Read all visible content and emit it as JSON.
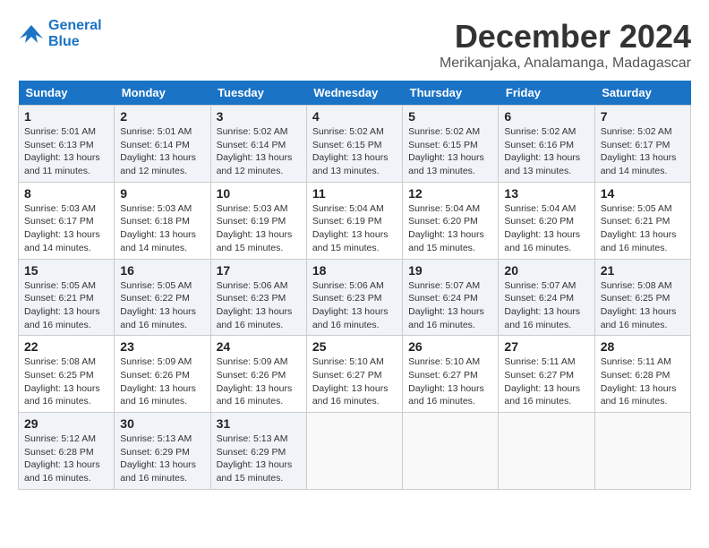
{
  "header": {
    "logo_line1": "General",
    "logo_line2": "Blue",
    "month_year": "December 2024",
    "location": "Merikanjaka, Analamanga, Madagascar"
  },
  "calendar": {
    "days_of_week": [
      "Sunday",
      "Monday",
      "Tuesday",
      "Wednesday",
      "Thursday",
      "Friday",
      "Saturday"
    ],
    "weeks": [
      [
        {
          "day": "",
          "info": ""
        },
        {
          "day": "2",
          "info": "Sunrise: 5:01 AM\nSunset: 6:14 PM\nDaylight: 13 hours\nand 12 minutes."
        },
        {
          "day": "3",
          "info": "Sunrise: 5:02 AM\nSunset: 6:14 PM\nDaylight: 13 hours\nand 12 minutes."
        },
        {
          "day": "4",
          "info": "Sunrise: 5:02 AM\nSunset: 6:15 PM\nDaylight: 13 hours\nand 13 minutes."
        },
        {
          "day": "5",
          "info": "Sunrise: 5:02 AM\nSunset: 6:15 PM\nDaylight: 13 hours\nand 13 minutes."
        },
        {
          "day": "6",
          "info": "Sunrise: 5:02 AM\nSunset: 6:16 PM\nDaylight: 13 hours\nand 13 minutes."
        },
        {
          "day": "7",
          "info": "Sunrise: 5:02 AM\nSunset: 6:17 PM\nDaylight: 13 hours\nand 14 minutes."
        }
      ],
      [
        {
          "day": "1",
          "info": "Sunrise: 5:01 AM\nSunset: 6:13 PM\nDaylight: 13 hours\nand 11 minutes."
        },
        null,
        null,
        null,
        null,
        null,
        null
      ],
      [
        {
          "day": "8",
          "info": "Sunrise: 5:03 AM\nSunset: 6:17 PM\nDaylight: 13 hours\nand 14 minutes."
        },
        {
          "day": "9",
          "info": "Sunrise: 5:03 AM\nSunset: 6:18 PM\nDaylight: 13 hours\nand 14 minutes."
        },
        {
          "day": "10",
          "info": "Sunrise: 5:03 AM\nSunset: 6:19 PM\nDaylight: 13 hours\nand 15 minutes."
        },
        {
          "day": "11",
          "info": "Sunrise: 5:04 AM\nSunset: 6:19 PM\nDaylight: 13 hours\nand 15 minutes."
        },
        {
          "day": "12",
          "info": "Sunrise: 5:04 AM\nSunset: 6:20 PM\nDaylight: 13 hours\nand 15 minutes."
        },
        {
          "day": "13",
          "info": "Sunrise: 5:04 AM\nSunset: 6:20 PM\nDaylight: 13 hours\nand 16 minutes."
        },
        {
          "day": "14",
          "info": "Sunrise: 5:05 AM\nSunset: 6:21 PM\nDaylight: 13 hours\nand 16 minutes."
        }
      ],
      [
        {
          "day": "15",
          "info": "Sunrise: 5:05 AM\nSunset: 6:21 PM\nDaylight: 13 hours\nand 16 minutes."
        },
        {
          "day": "16",
          "info": "Sunrise: 5:05 AM\nSunset: 6:22 PM\nDaylight: 13 hours\nand 16 minutes."
        },
        {
          "day": "17",
          "info": "Sunrise: 5:06 AM\nSunset: 6:23 PM\nDaylight: 13 hours\nand 16 minutes."
        },
        {
          "day": "18",
          "info": "Sunrise: 5:06 AM\nSunset: 6:23 PM\nDaylight: 13 hours\nand 16 minutes."
        },
        {
          "day": "19",
          "info": "Sunrise: 5:07 AM\nSunset: 6:24 PM\nDaylight: 13 hours\nand 16 minutes."
        },
        {
          "day": "20",
          "info": "Sunrise: 5:07 AM\nSunset: 6:24 PM\nDaylight: 13 hours\nand 16 minutes."
        },
        {
          "day": "21",
          "info": "Sunrise: 5:08 AM\nSunset: 6:25 PM\nDaylight: 13 hours\nand 16 minutes."
        }
      ],
      [
        {
          "day": "22",
          "info": "Sunrise: 5:08 AM\nSunset: 6:25 PM\nDaylight: 13 hours\nand 16 minutes."
        },
        {
          "day": "23",
          "info": "Sunrise: 5:09 AM\nSunset: 6:26 PM\nDaylight: 13 hours\nand 16 minutes."
        },
        {
          "day": "24",
          "info": "Sunrise: 5:09 AM\nSunset: 6:26 PM\nDaylight: 13 hours\nand 16 minutes."
        },
        {
          "day": "25",
          "info": "Sunrise: 5:10 AM\nSunset: 6:27 PM\nDaylight: 13 hours\nand 16 minutes."
        },
        {
          "day": "26",
          "info": "Sunrise: 5:10 AM\nSunset: 6:27 PM\nDaylight: 13 hours\nand 16 minutes."
        },
        {
          "day": "27",
          "info": "Sunrise: 5:11 AM\nSunset: 6:27 PM\nDaylight: 13 hours\nand 16 minutes."
        },
        {
          "day": "28",
          "info": "Sunrise: 5:11 AM\nSunset: 6:28 PM\nDaylight: 13 hours\nand 16 minutes."
        }
      ],
      [
        {
          "day": "29",
          "info": "Sunrise: 5:12 AM\nSunset: 6:28 PM\nDaylight: 13 hours\nand 16 minutes."
        },
        {
          "day": "30",
          "info": "Sunrise: 5:13 AM\nSunset: 6:29 PM\nDaylight: 13 hours\nand 16 minutes."
        },
        {
          "day": "31",
          "info": "Sunrise: 5:13 AM\nSunset: 6:29 PM\nDaylight: 13 hours\nand 15 minutes."
        },
        {
          "day": "",
          "info": ""
        },
        {
          "day": "",
          "info": ""
        },
        {
          "day": "",
          "info": ""
        },
        {
          "day": "",
          "info": ""
        }
      ]
    ]
  }
}
